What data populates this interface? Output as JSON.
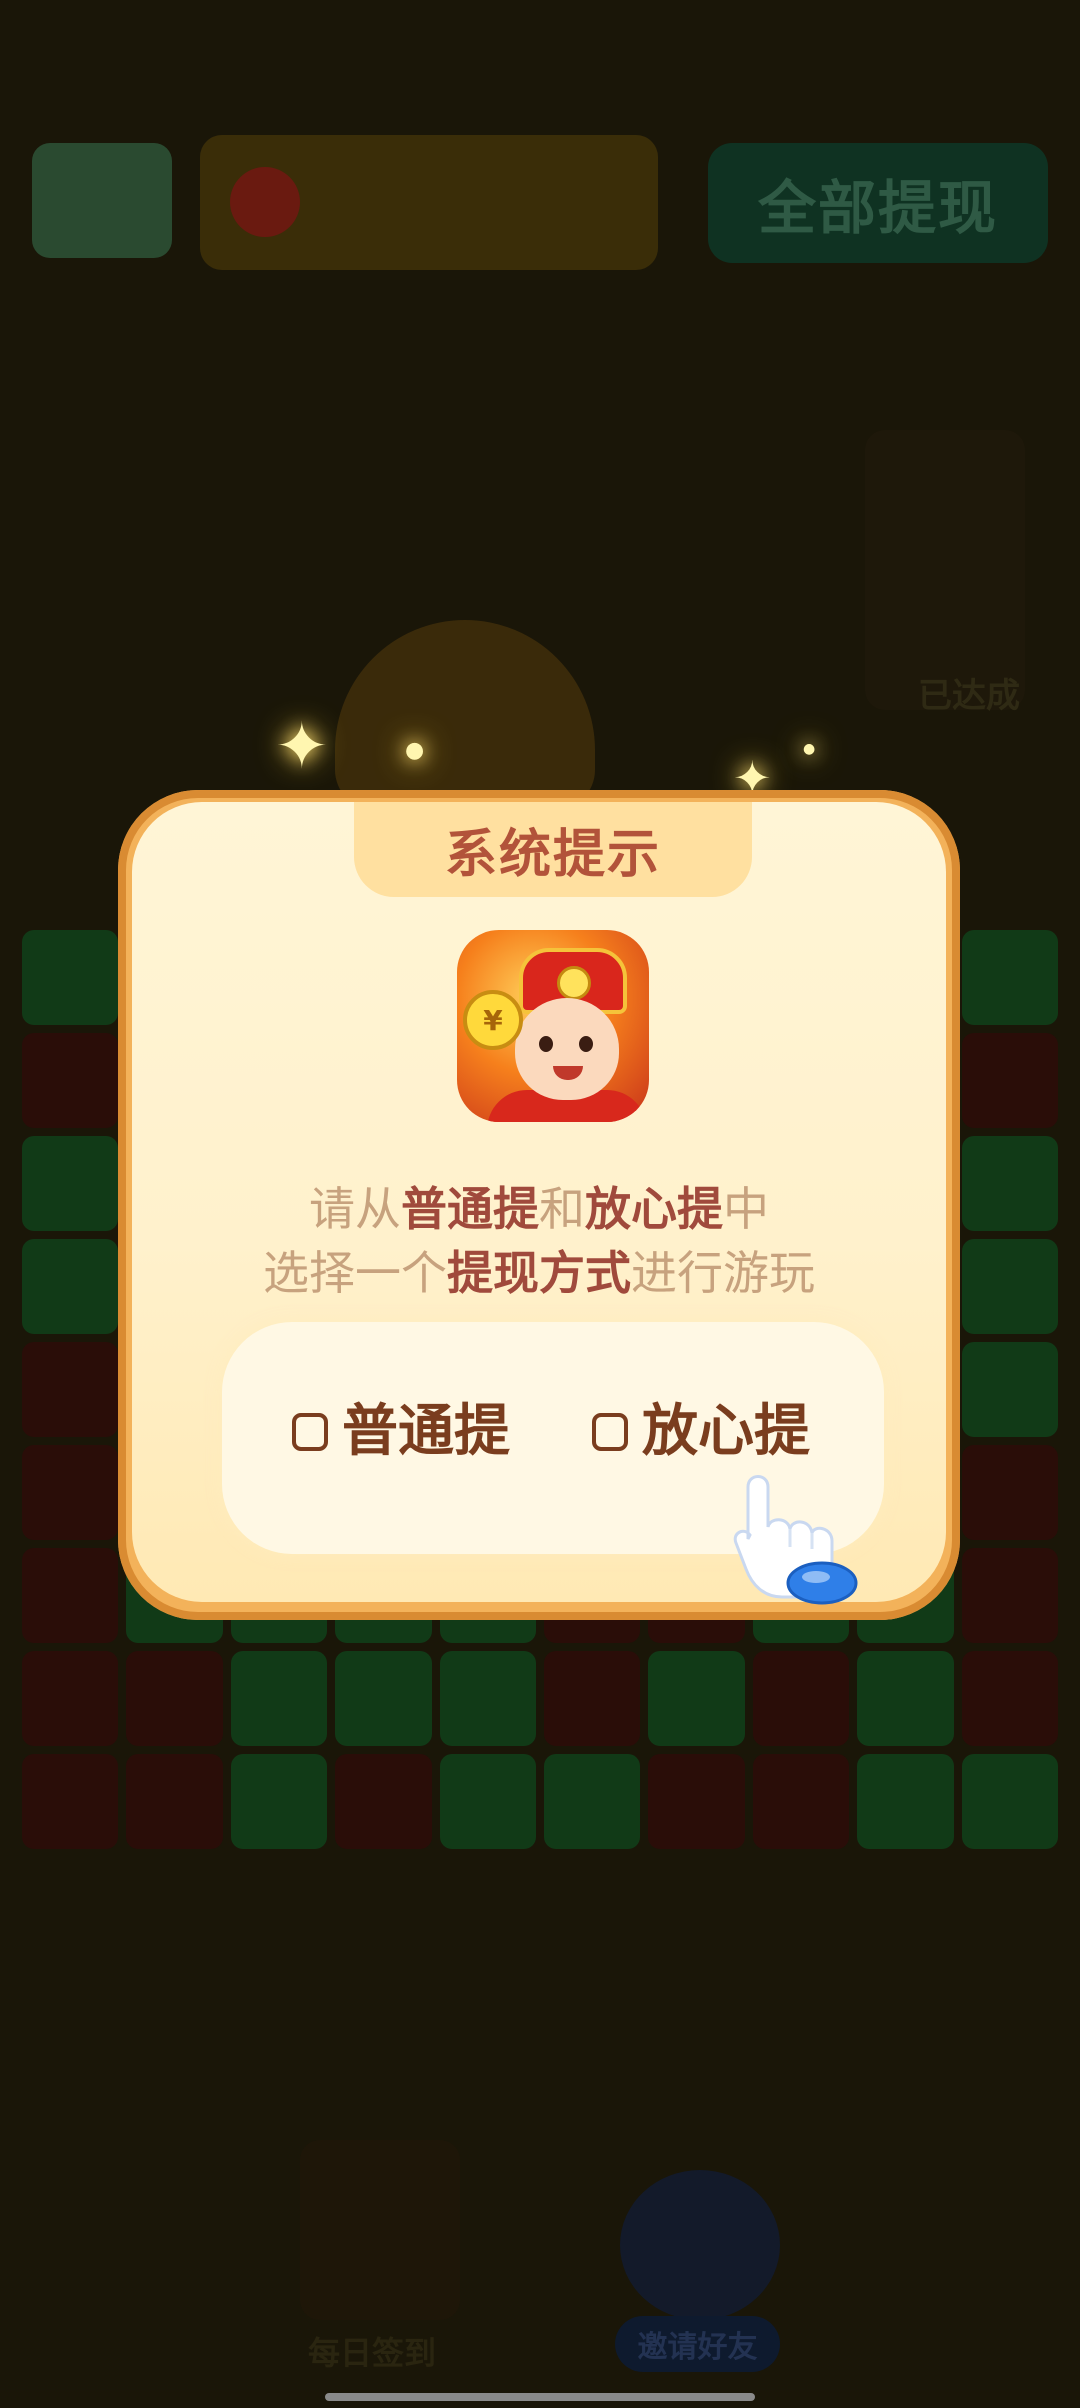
{
  "background": {
    "withdraw_all_label": "全部提现",
    "reward_label": "已达成",
    "bottom_left_label": "每日签到",
    "bottom_right_label": "邀请好友"
  },
  "dialog": {
    "title": "系统提示",
    "message": {
      "line1_prefix": "请从",
      "line1_hl1": "普通提",
      "line1_mid": "和",
      "line1_hl2": "放心提",
      "line1_suffix": "中",
      "line2_prefix": "选择一个",
      "line2_hl": "提现方式",
      "line2_suffix": "进行游玩"
    },
    "options": [
      {
        "label": "普通提",
        "checked": false
      },
      {
        "label": "放心提",
        "checked": false
      }
    ],
    "app_icon_name": "app-icon-god-of-wealth",
    "pointer_icon_name": "pointing-hand-icon"
  },
  "colors": {
    "dialog_border": "#f3b25a",
    "dialog_fill": "#fff5d6",
    "title_text": "#b2533a",
    "highlight_text": "#a04a3c",
    "muted_text": "#c7a27e",
    "option_text": "#7a3d1e"
  }
}
